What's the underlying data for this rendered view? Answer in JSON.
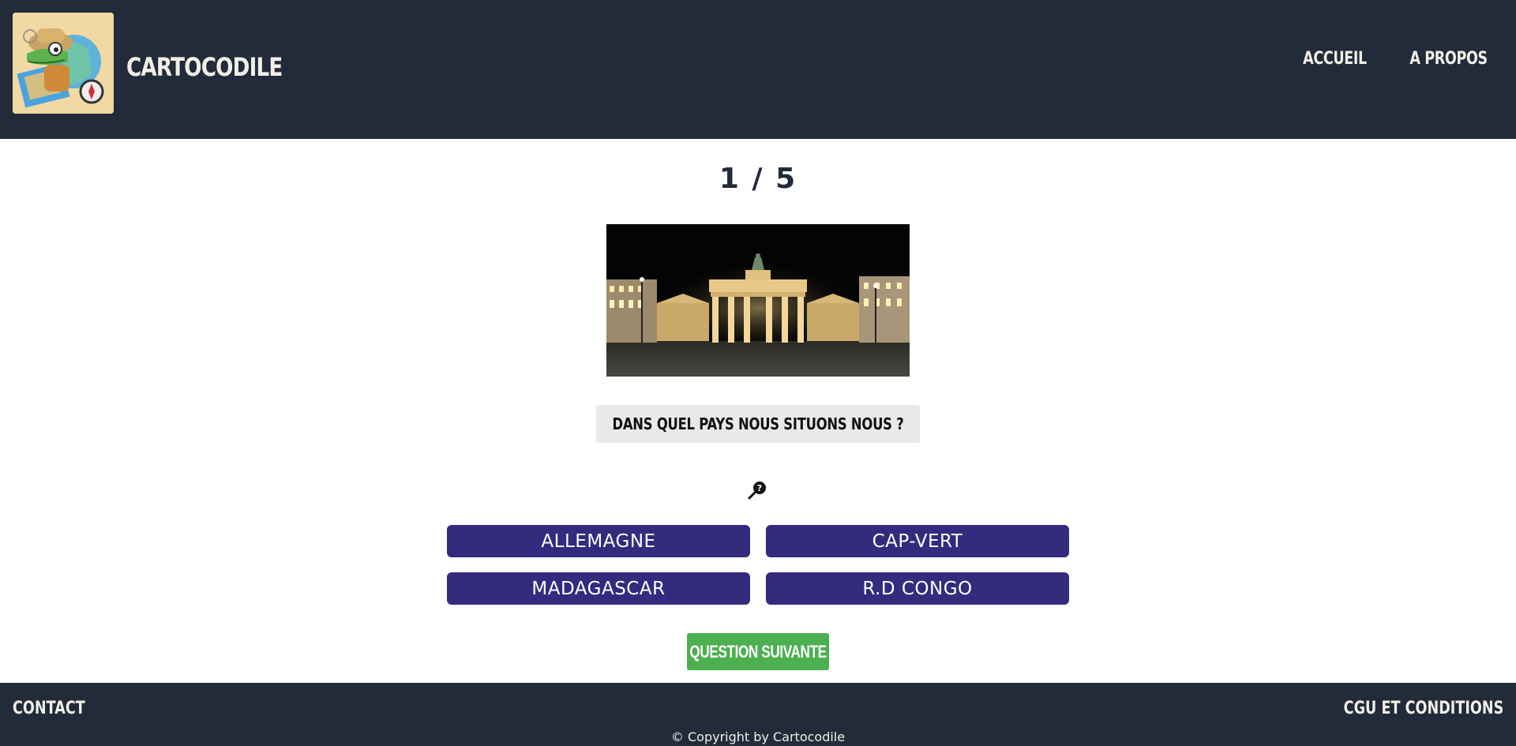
{
  "header": {
    "brand": "CARTOCODILE",
    "nav": [
      {
        "label": "ACCUEIL"
      },
      {
        "label": "A PROPOS"
      }
    ]
  },
  "quiz": {
    "counter": "1 / 5",
    "question": "DANS QUEL PAYS NOUS SITUONS NOUS ?",
    "answers": [
      {
        "label": "ALLEMAGNE"
      },
      {
        "label": "CAP-VERT"
      },
      {
        "label": "MADAGASCAR"
      },
      {
        "label": "R.D CONGO"
      }
    ],
    "next_label": "QUESTION SUIVANTE",
    "hint_icon": "magnifier-question-icon",
    "image_icon": "brandenburg-gate-photo"
  },
  "footer": {
    "contact": "CONTACT",
    "cgu": "CGU ET CONDITIONS",
    "copyright": "© Copyright by Cartocodile"
  },
  "colors": {
    "header_bg": "#212b39",
    "answer_bg": "#342b7f",
    "next_bg": "#4caf50",
    "question_bg": "#e9e9e9"
  }
}
